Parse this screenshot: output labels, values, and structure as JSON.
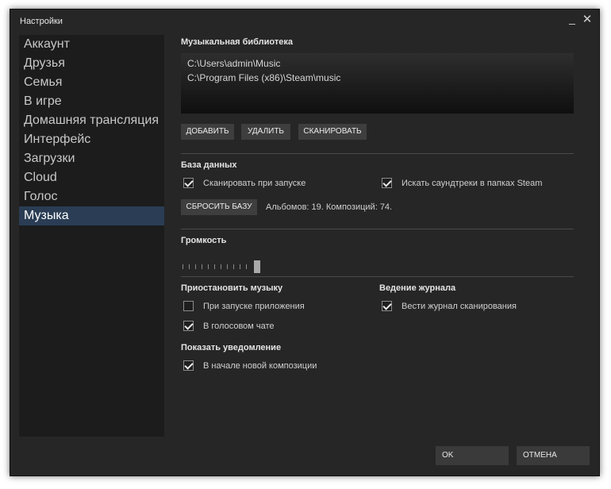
{
  "window": {
    "title": "Настройки"
  },
  "sidebar": {
    "items": [
      {
        "label": "Аккаунт"
      },
      {
        "label": "Друзья"
      },
      {
        "label": "Семья"
      },
      {
        "label": "В игре"
      },
      {
        "label": "Домашняя трансляция"
      },
      {
        "label": "Интерфейс"
      },
      {
        "label": "Загрузки"
      },
      {
        "label": "Cloud"
      },
      {
        "label": "Голос"
      },
      {
        "label": "Музыка",
        "selected": true
      }
    ]
  },
  "music_library": {
    "title": "Музыкальная библиотека",
    "paths": [
      "C:\\Users\\admin\\Music",
      "C:\\Program Files (x86)\\Steam\\music"
    ],
    "add_label": "ДОБАВИТЬ",
    "remove_label": "УДАЛИТЬ",
    "scan_label": "СКАНИРОВАТЬ"
  },
  "database": {
    "title": "База данных",
    "scan_on_start": {
      "label": "Сканировать при запуске",
      "checked": true
    },
    "search_soundtracks": {
      "label": "Искать саундтреки в папках Steam",
      "checked": true
    },
    "reset_label": "СБРОСИТЬ БАЗУ",
    "stats": "Альбомов: 19. Композиций: 74."
  },
  "volume": {
    "title": "Громкость",
    "level": 1.0
  },
  "pause_music": {
    "title": "Приостановить музыку",
    "on_app_start": {
      "label": "При запуске приложения",
      "checked": false
    },
    "in_voice_chat": {
      "label": "В голосовом чате",
      "checked": true
    }
  },
  "logging": {
    "title": "Ведение журнала",
    "log_scan": {
      "label": "Вести журнал сканирования",
      "checked": true
    }
  },
  "notification": {
    "title": "Показать уведомление",
    "on_new_track": {
      "label": "В начале новой композиции",
      "checked": true
    }
  },
  "footer": {
    "ok_label": "OK",
    "cancel_label": "ОТМЕНА"
  },
  "colors": {
    "selection": "#2a3d54",
    "window_bg": "#262626",
    "sidebar_bg": "#1c1c1c"
  }
}
